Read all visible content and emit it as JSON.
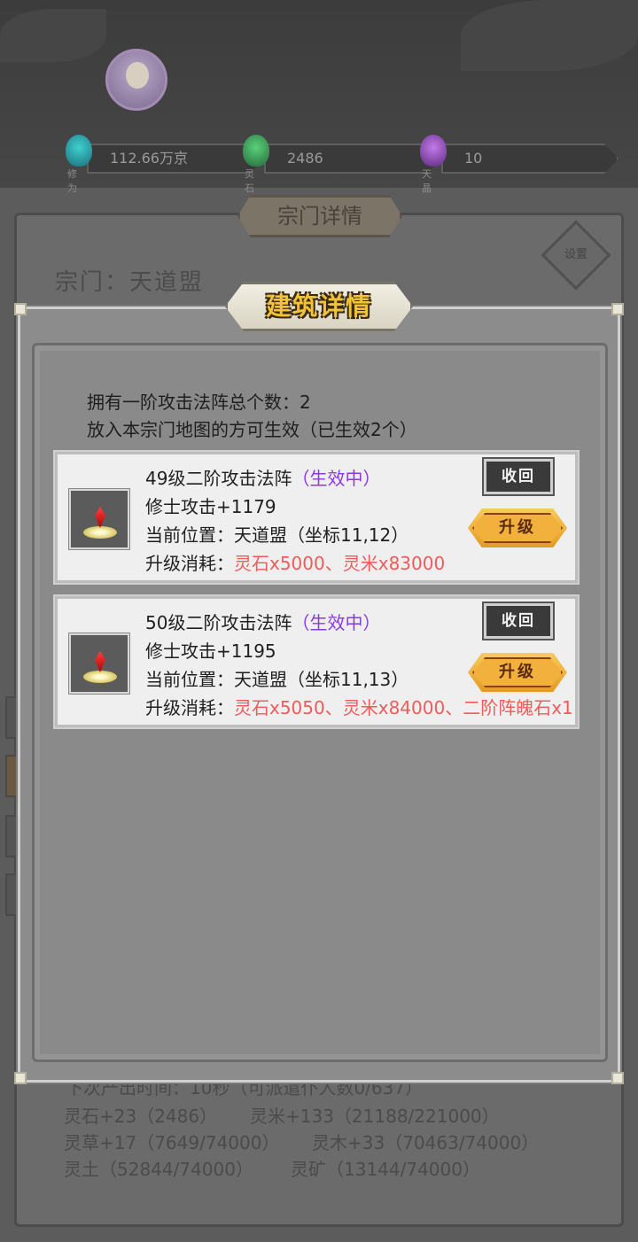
{
  "resources": [
    {
      "icon": "cultivation-icon",
      "label": "修为",
      "value": "112.66万京",
      "color": "#2aa6a6"
    },
    {
      "icon": "spirit-stone-icon",
      "label": "灵石",
      "value": "2486",
      "color": "#3aa05a"
    },
    {
      "icon": "sky-crystal-icon",
      "label": "天晶",
      "value": "10",
      "color": "#9a4fc9"
    }
  ],
  "sect": {
    "title": "宗门详情",
    "settings_label": "设置",
    "name": "宗门：天道盟",
    "footer": {
      "line1": "下次产出时间：10秒（可派遣仆人数0/637）",
      "line2_a": "灵石+23（2486）",
      "line2_b": "灵米+133（21188/221000）",
      "line3_a": "灵草+17（7649/74000）",
      "line3_b": "灵木+33（70463/74000）",
      "line4_a": "灵土（52844/74000）",
      "line4_b": "灵矿（13144/74000）"
    }
  },
  "modal": {
    "title": "建筑详情",
    "summary_line1": "拥有一阶攻击法阵总个数：2",
    "summary_line2": "放入本宗门地图的方可生效（已生效2个）",
    "items": [
      {
        "name": "49级二阶攻击法阵",
        "status": "（生效中）",
        "attack": "修士攻击+1179",
        "location": "当前位置：天道盟（坐标11,12）",
        "cost_label": "升级消耗：",
        "cost": "灵石x5000、灵米x83000",
        "recall_label": "收回",
        "upgrade_label": "升级"
      },
      {
        "name": "50级二阶攻击法阵",
        "status": "（生效中）",
        "attack": "修士攻击+1195",
        "location": "当前位置：天道盟（坐标11,13）",
        "cost_label": "升级消耗：",
        "cost": "灵石x5050、灵米x84000、二阶阵魄石x1",
        "recall_label": "收回",
        "upgrade_label": "升级"
      }
    ]
  },
  "colors": {
    "status": "#8a3ae0",
    "cost": "#ef5b5b",
    "title_gold": "#f2c23a"
  }
}
